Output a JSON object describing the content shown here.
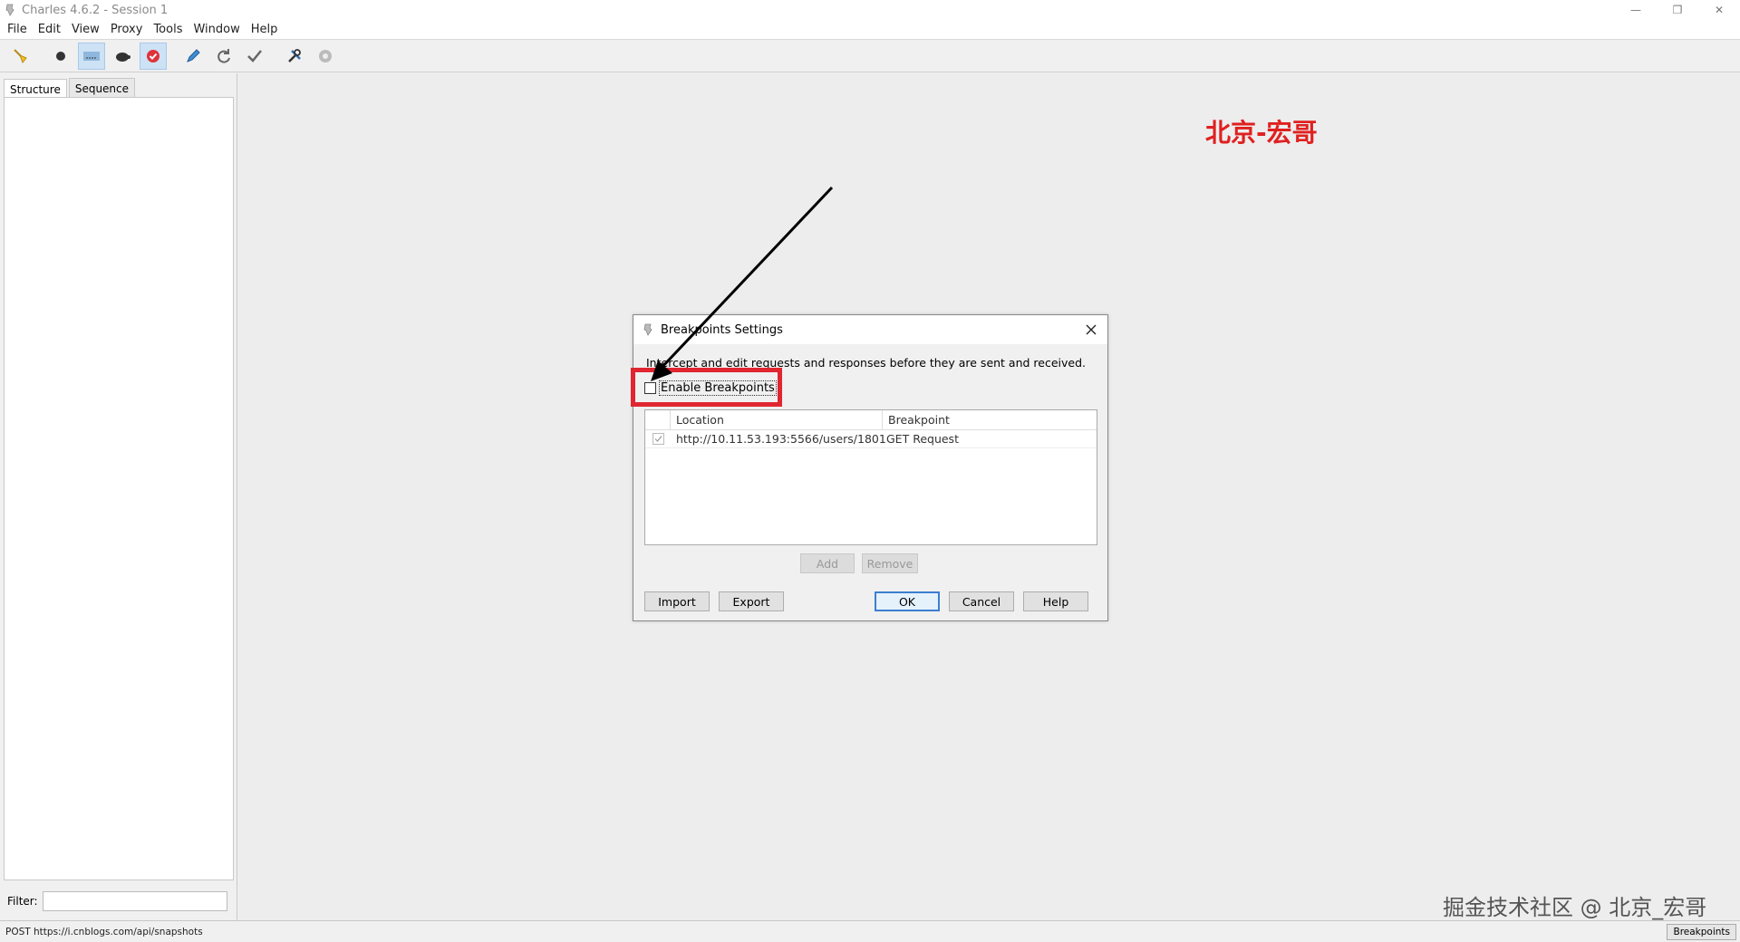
{
  "window": {
    "title": "Charles 4.6.2 - Session 1"
  },
  "menu": [
    "File",
    "Edit",
    "View",
    "Proxy",
    "Tools",
    "Window",
    "Help"
  ],
  "toolbar": {
    "icons": [
      "broom-icon",
      "record-icon",
      "throttle-icon",
      "turtle-icon",
      "breakpoint-icon",
      "pen-icon",
      "refresh-icon",
      "check-icon",
      "tools-icon",
      "settings-icon"
    ]
  },
  "left_pane": {
    "tabs": [
      "Structure",
      "Sequence"
    ],
    "filter_label": "Filter:",
    "filter_value": ""
  },
  "watermark": {
    "top": "北京-宏哥",
    "bottom": "掘金技术社区 @ 北京_宏哥"
  },
  "dialog": {
    "title": "Breakpoints Settings",
    "description": "Intercept and edit requests and responses before they are sent and received.",
    "enable_label": "Enable Breakpoints",
    "enable_checked": false,
    "columns": [
      "Location",
      "Breakpoint"
    ],
    "rows": [
      {
        "location": "http://10.11.53.193:5566/users/1801",
        "breakpoint": "GET Request",
        "checked": true
      }
    ],
    "buttons": {
      "add": "Add",
      "remove": "Remove",
      "import": "Import",
      "export": "Export",
      "ok": "OK",
      "cancel": "Cancel",
      "help": "Help"
    }
  },
  "status": {
    "text": "POST https://i.cnblogs.com/api/snapshots",
    "badge": "Breakpoints"
  },
  "colors": {
    "highlight": "#e02630",
    "watermark": "#e02020"
  }
}
